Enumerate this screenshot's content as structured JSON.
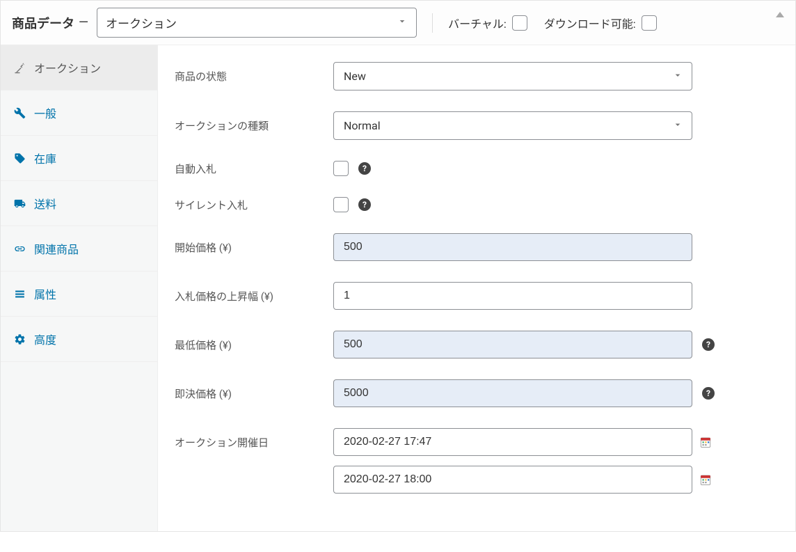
{
  "header": {
    "title": "商品データ",
    "product_type_value": "オークション",
    "virtual_label": "バーチャル:",
    "downloadable_label": "ダウンロード可能:"
  },
  "sidebar": {
    "items": [
      {
        "label": "オークション"
      },
      {
        "label": "一般"
      },
      {
        "label": "在庫"
      },
      {
        "label": "送料"
      },
      {
        "label": "関連商品"
      },
      {
        "label": "属性"
      },
      {
        "label": "高度"
      }
    ]
  },
  "fields": {
    "condition": {
      "label": "商品の状態",
      "value": "New"
    },
    "auction_type": {
      "label": "オークションの種類",
      "value": "Normal"
    },
    "proxy_bidding": {
      "label": "自動入札"
    },
    "sealed_bidding": {
      "label": "サイレント入札"
    },
    "start_price": {
      "label": "開始価格 (¥)",
      "value": "500"
    },
    "bid_increment": {
      "label": "入札価格の上昇幅 (¥)",
      "value": "1"
    },
    "reserve_price": {
      "label": "最低価格 (¥)",
      "value": "500"
    },
    "buyout_price": {
      "label": "即決価格 (¥)",
      "value": "5000"
    },
    "auction_dates": {
      "label": "オークション開催日",
      "from": "2020-02-27 17:47",
      "to": "2020-02-27 18:00"
    }
  }
}
